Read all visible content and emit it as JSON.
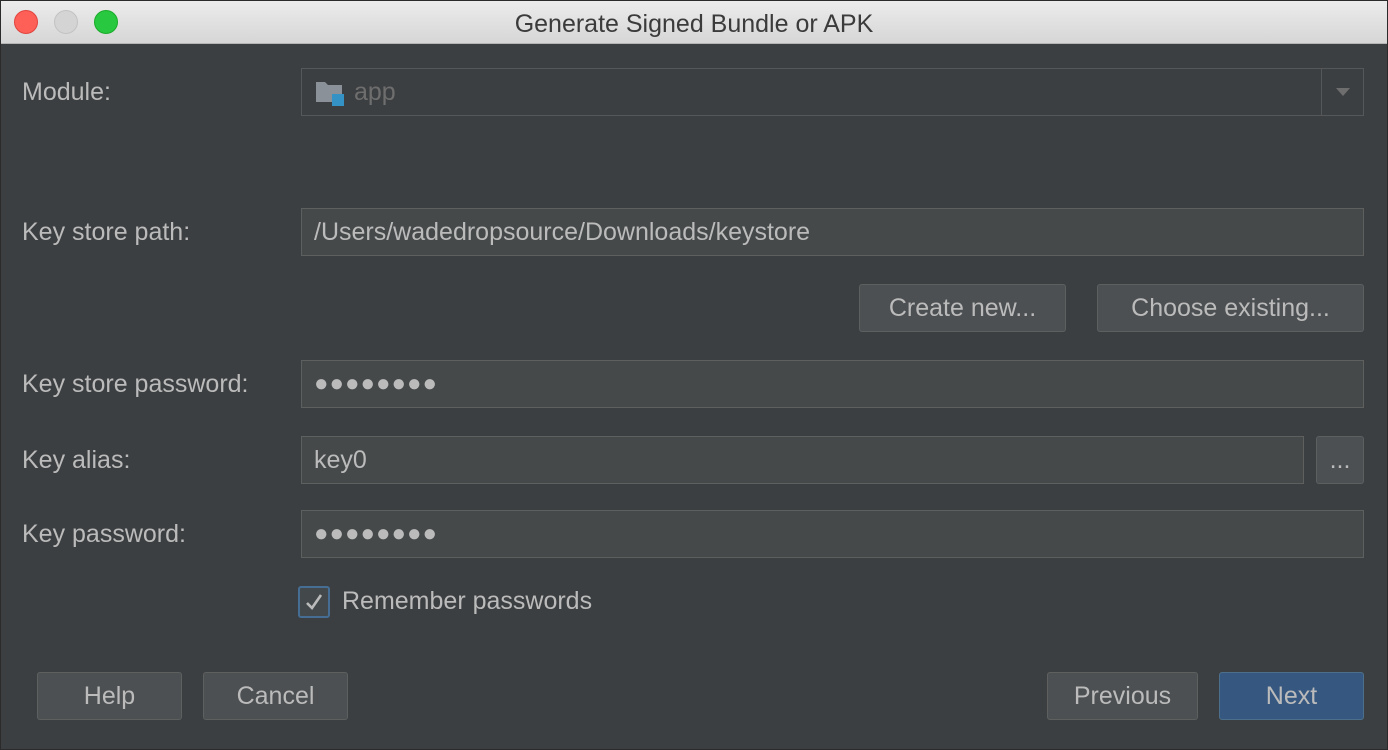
{
  "window": {
    "title": "Generate Signed Bundle or APK"
  },
  "module": {
    "label": "Module:",
    "value": "app"
  },
  "keystore": {
    "path_label": "Key store path:",
    "path_value": "/Users/wadedropsource/Downloads/keystore",
    "create_new": "Create new...",
    "choose_existing": "Choose existing...",
    "password_label": "Key store password:",
    "password_mask": "●●●●●●●●"
  },
  "key": {
    "alias_label": "Key alias:",
    "alias_value": "key0",
    "browse": "...",
    "password_label": "Key password:",
    "password_mask": "●●●●●●●●"
  },
  "remember": {
    "label": "Remember passwords",
    "checked": true
  },
  "footer": {
    "help": "Help",
    "cancel": "Cancel",
    "previous": "Previous",
    "next": "Next"
  },
  "colors": {
    "background": "#3c3f41",
    "field": "#45494a",
    "primary": "#365880",
    "checkbox_border": "#466d94"
  },
  "icons": {
    "module": "module-folder-icon",
    "dropdown": "chevron-down-icon",
    "check": "checkmark-icon"
  }
}
